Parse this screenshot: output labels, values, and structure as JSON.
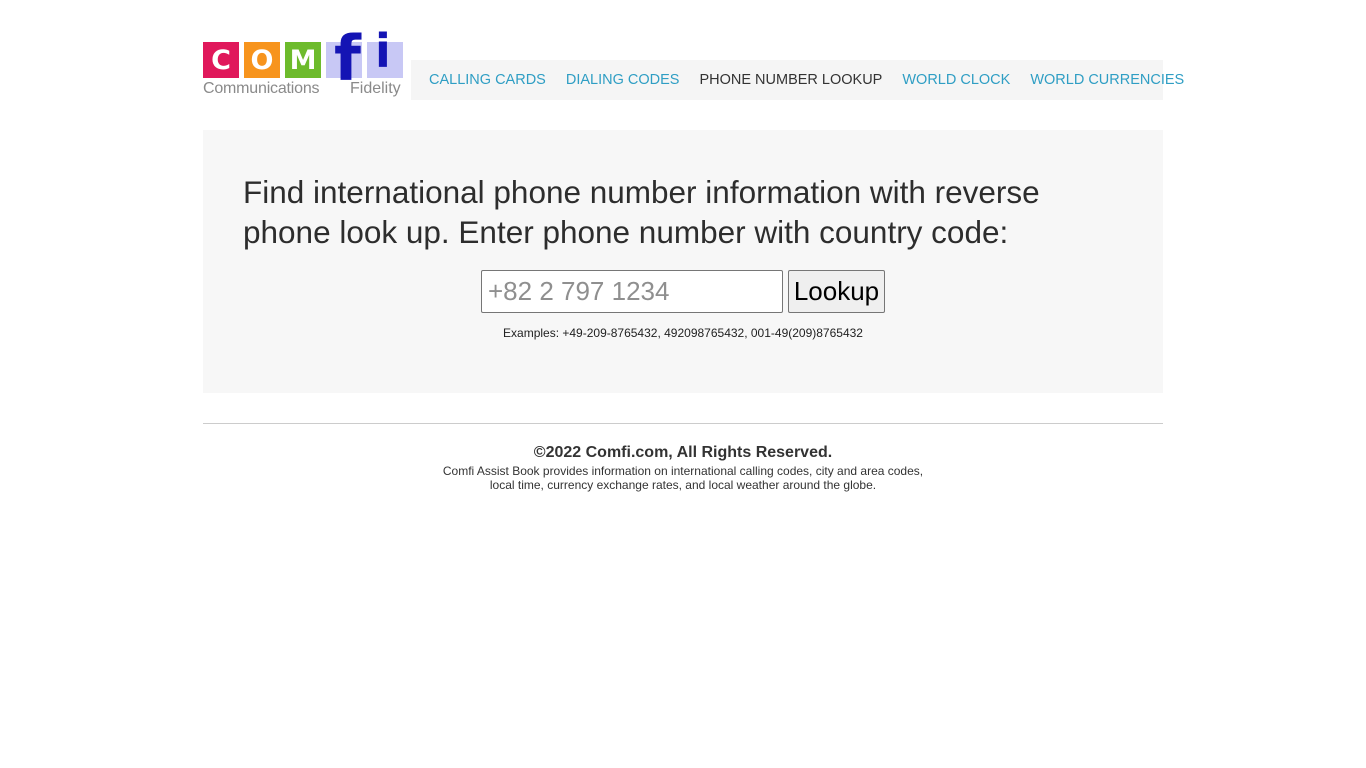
{
  "logo": {
    "letters": [
      "C",
      "O",
      "M",
      "f",
      "i"
    ],
    "tagline_left": "Communications",
    "tagline_right": "Fidelity",
    "colors": {
      "c": "#e0185b",
      "o": "#f7941d",
      "m": "#6dbb2c",
      "fi_background": "#c8c8f5",
      "fi_letters": "#1414b4"
    }
  },
  "nav": {
    "items": [
      {
        "label": "CALLING CARDS",
        "active": false
      },
      {
        "label": "DIALING CODES",
        "active": false
      },
      {
        "label": "PHONE NUMBER LOOKUP",
        "active": true
      },
      {
        "label": "WORLD CLOCK",
        "active": false
      },
      {
        "label": "WORLD CURRENCIES",
        "active": false
      }
    ],
    "link_color": "#2f9ec4",
    "active_color": "#333333"
  },
  "main": {
    "heading": "Find international phone number information with reverse phone look up. Enter phone number with country code:",
    "phone_input": {
      "value": "",
      "placeholder": "+82 2 797 1234"
    },
    "lookup_button": "Lookup",
    "examples": "Examples: +49-209-8765432, 492098765432, 001-49(209)8765432"
  },
  "footer": {
    "copyright": "©2022 Comfi.com, All Rights Reserved.",
    "description_line1": "Comfi Assist Book provides information on international calling codes, city and area codes,",
    "description_line2": "local time, currency exchange rates, and local weather around the globe."
  }
}
